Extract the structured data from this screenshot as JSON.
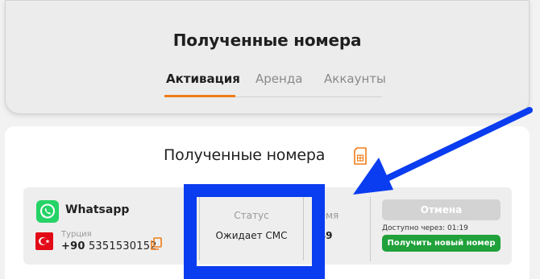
{
  "header": {
    "title": "Полученные номера",
    "tabs": [
      {
        "label": "Активация",
        "active": true
      },
      {
        "label": "Аренда",
        "active": false
      },
      {
        "label": "Аккаунты",
        "active": false
      }
    ]
  },
  "section": {
    "title": "Полученные номера",
    "icon": "sim-card-icon"
  },
  "number_row": {
    "service": "Whatsapp",
    "service_icon": "whatsapp-icon",
    "country": "Турция",
    "country_icon": "turkey-flag-icon",
    "phone_prefix": "+90",
    "phone_number": "5351530152",
    "copy_icon": "copy-icon",
    "status_label": "Статус",
    "status_value": "Ожидает СМС",
    "time_label": "ремя",
    "time_value": ":49",
    "cancel_label": "Отмена",
    "available_text": "Доступно через: 01:19",
    "new_number_label": "Получить новый номер"
  },
  "colors": {
    "accent": "#f07d1a",
    "green": "#20a13a",
    "annotation_blue": "#0a3cf0",
    "whatsapp_green": "#25d366",
    "flag_red": "#e30a17"
  }
}
